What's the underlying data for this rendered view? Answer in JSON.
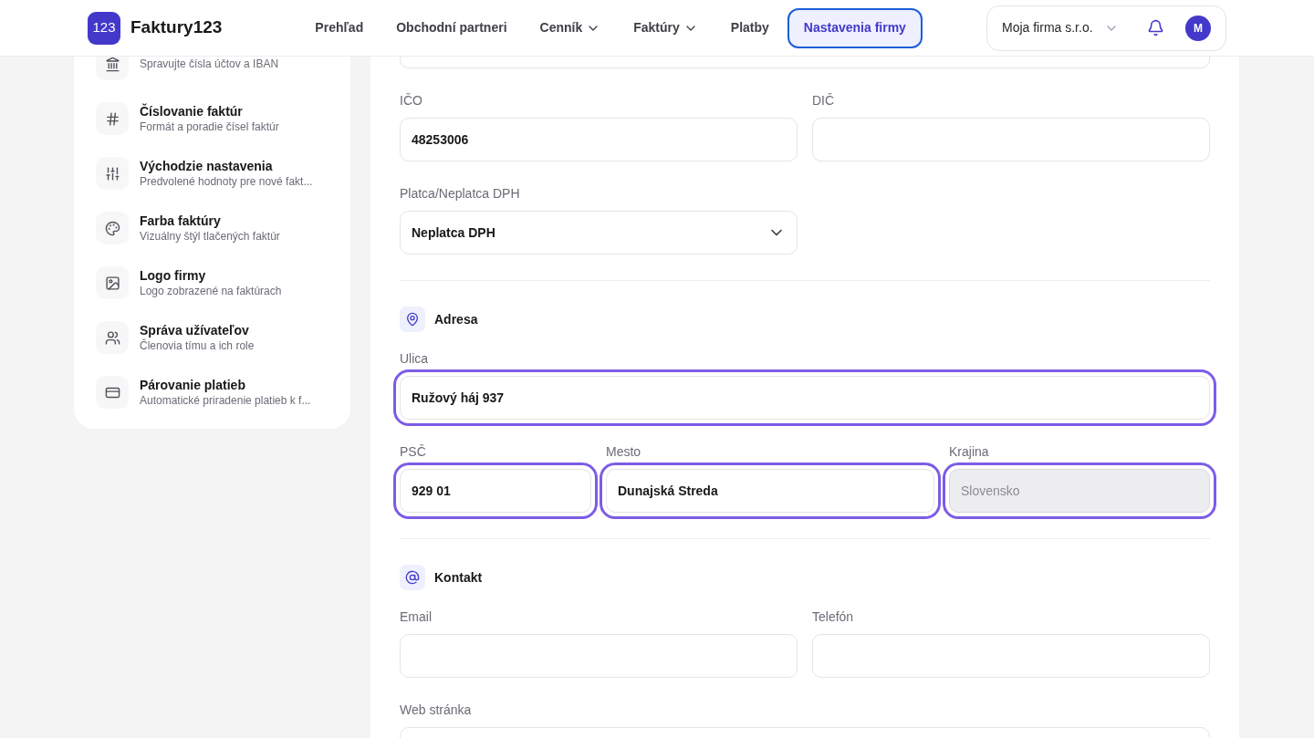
{
  "header": {
    "logo_mark": "123",
    "brand": "Faktury123",
    "nav": [
      {
        "label": "Prehľad",
        "has_caret": false,
        "selected": false
      },
      {
        "label": "Obchodní partneri",
        "has_caret": false,
        "selected": false
      },
      {
        "label": "Cenník",
        "has_caret": true,
        "selected": false
      },
      {
        "label": "Faktúry",
        "has_caret": true,
        "selected": false
      },
      {
        "label": "Platby",
        "has_caret": false,
        "selected": false
      },
      {
        "label": "Nastavenia firmy",
        "has_caret": false,
        "selected": true
      }
    ],
    "company": "Moja firma s.r.o.",
    "avatar": "M"
  },
  "sidebar": {
    "items": [
      {
        "subtitle": "Spravujte čísla účtov a IBAN"
      },
      {
        "title": "Číslovanie faktúr",
        "subtitle": "Formát a poradie čísel faktúr"
      },
      {
        "title": "Východzie nastavenia",
        "subtitle": "Predvolené hodnoty pre nové fakt..."
      },
      {
        "title": "Farba faktúry",
        "subtitle": "Vizuálny štýl tlačených faktúr"
      },
      {
        "title": "Logo firmy",
        "subtitle": "Logo zobrazené na faktúrach"
      },
      {
        "title": "Správa užívateľov",
        "subtitle": "Členovia tímu a ich role"
      },
      {
        "title": "Párovanie platieb",
        "subtitle": "Automatické priradenie platieb k f..."
      }
    ]
  },
  "form": {
    "sections": [
      {
        "rows": [
          {
            "fields": [
              {
                "label": "IČO",
                "value": "48253006",
                "kind": "input",
                "disabled": false,
                "highlighted": false
              },
              {
                "label": "DIČ",
                "kind": "input",
                "disabled": false,
                "highlighted": false
              }
            ]
          },
          {
            "fields": [
              {
                "label": "Platca/Neplatca DPH",
                "value": "Neplatca DPH",
                "kind": "select",
                "disabled": false,
                "highlighted": false
              }
            ]
          }
        ]
      },
      {
        "heading": "Adresa",
        "rows": [
          {
            "fields": [
              {
                "label": "Ulica",
                "value": "Ružový háj 937",
                "kind": "input",
                "disabled": false,
                "highlighted": true
              }
            ]
          },
          {
            "fields": [
              {
                "label": "PSČ",
                "value": "929 01",
                "kind": "input",
                "disabled": false,
                "highlighted": true
              },
              {
                "label": "Mesto",
                "value": "Dunajská Streda",
                "kind": "input",
                "disabled": false,
                "highlighted": true
              },
              {
                "label": "Krajina",
                "value": "Slovensko",
                "kind": "input",
                "disabled": true,
                "highlighted": true
              }
            ]
          }
        ]
      },
      {
        "heading": "Kontakt",
        "rows": [
          {
            "fields": [
              {
                "label": "Email",
                "kind": "input",
                "disabled": false,
                "highlighted": false
              },
              {
                "label": "Telefón",
                "kind": "input",
                "disabled": false,
                "highlighted": false
              }
            ]
          },
          {
            "fields": [
              {
                "label": "Web stránka",
                "kind": "input",
                "disabled": false,
                "highlighted": false
              }
            ]
          }
        ]
      }
    ]
  }
}
